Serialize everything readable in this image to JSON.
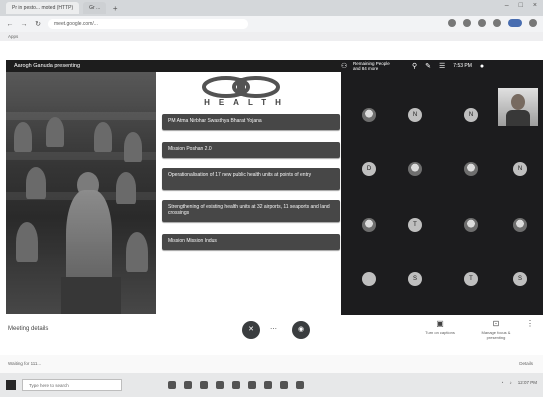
{
  "browser": {
    "tab_active": "Pr in pesto... moted (HTTP) ",
    "tab_inactive": "Gr ... ",
    "new_tab": "+",
    "window_controls": [
      "–",
      "□",
      "×"
    ],
    "url": "meet.google.com/...",
    "bookmarks": "Apps"
  },
  "meeting": {
    "presenter_label": "Aarogh Ganuda presenting",
    "grid_title": "Remaining People and 84 more",
    "top_icons": [
      "people-icon",
      "chat-icon",
      "activities-icon"
    ],
    "top_time": "7:53 PM",
    "slide": {
      "logo_text": "HEALTH",
      "items": [
        "PM Atma Nirbhar Swasthya Bharat Yojana",
        "Mission Poshan 2.0",
        "Operationalisation of 17 new public health units at points of entry",
        "Strengthening of existing health units at 32 airports, 11 seaports and land crossings",
        "Mission Mission Indus"
      ]
    },
    "grid_tiles": [
      "",
      "N",
      "N",
      "",
      "D",
      "",
      "",
      "N",
      "",
      "T",
      "",
      "",
      "",
      "S",
      "T",
      "S"
    ]
  },
  "controls": {
    "meeting_name": "Meeting details",
    "mic_icon": "mic-off-icon",
    "cam_icon": "camera-off-icon",
    "hangup_icon": "end-call-icon",
    "right_1_label": "Turn on captions",
    "right_2_label": "Manage focus & presenting"
  },
  "status_bar": {
    "left": "Waiting for 111...",
    "right": "Details"
  },
  "taskbar": {
    "search_placeholder": "Type here to search",
    "time": "12:07 PM"
  }
}
